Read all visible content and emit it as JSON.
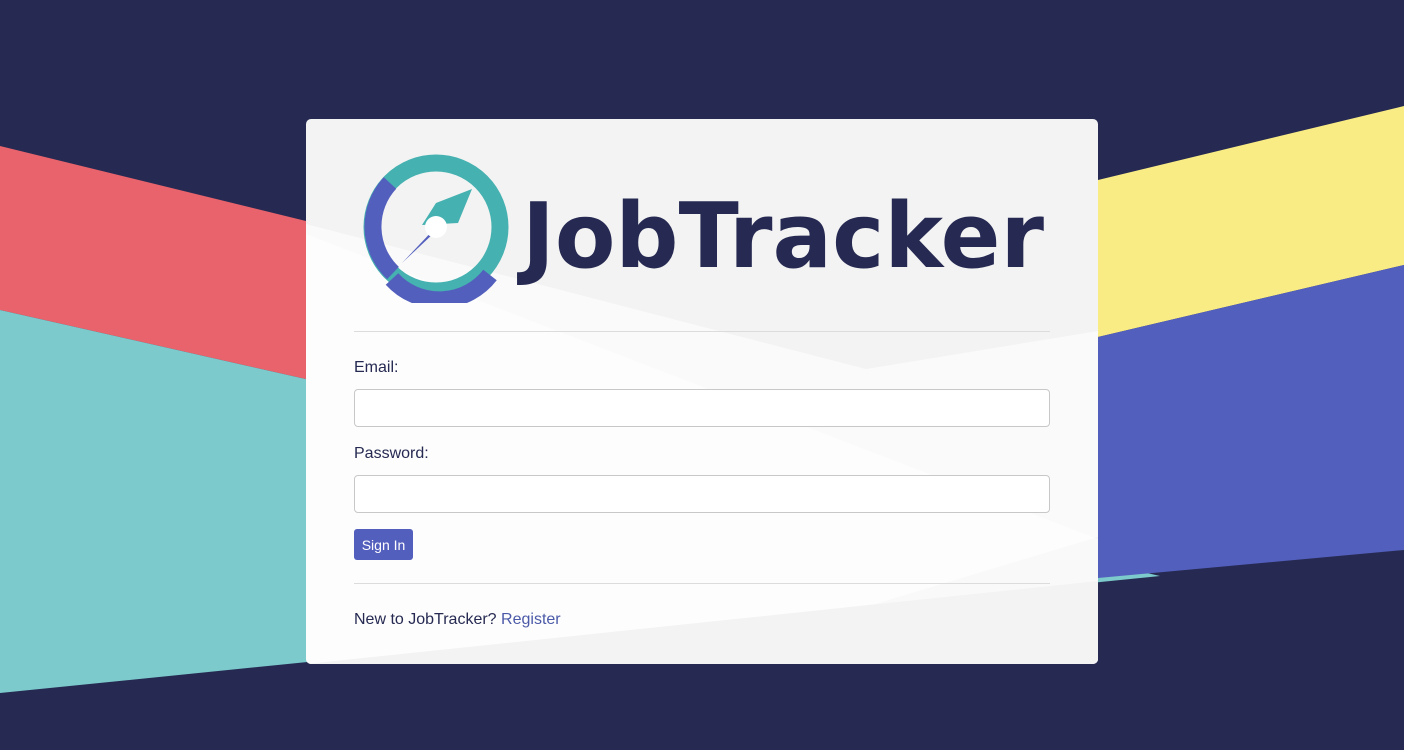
{
  "app": {
    "name": "JobTracker"
  },
  "form": {
    "email_label": "Email:",
    "email_value": "",
    "password_label": "Password:",
    "password_value": "",
    "submit_label": "Sign In"
  },
  "footer": {
    "prompt": "New to JobTracker?",
    "register_link": "Register"
  },
  "colors": {
    "background": "#262a52",
    "coral": "#e8636b",
    "teal": "#7ccacb",
    "yellow": "#f9ec85",
    "indigo": "#535fbd",
    "button": "#535fbd",
    "logo_teal": "#45b1b0",
    "logo_navy": "#262a52"
  },
  "icons": [
    "compass-icon"
  ]
}
